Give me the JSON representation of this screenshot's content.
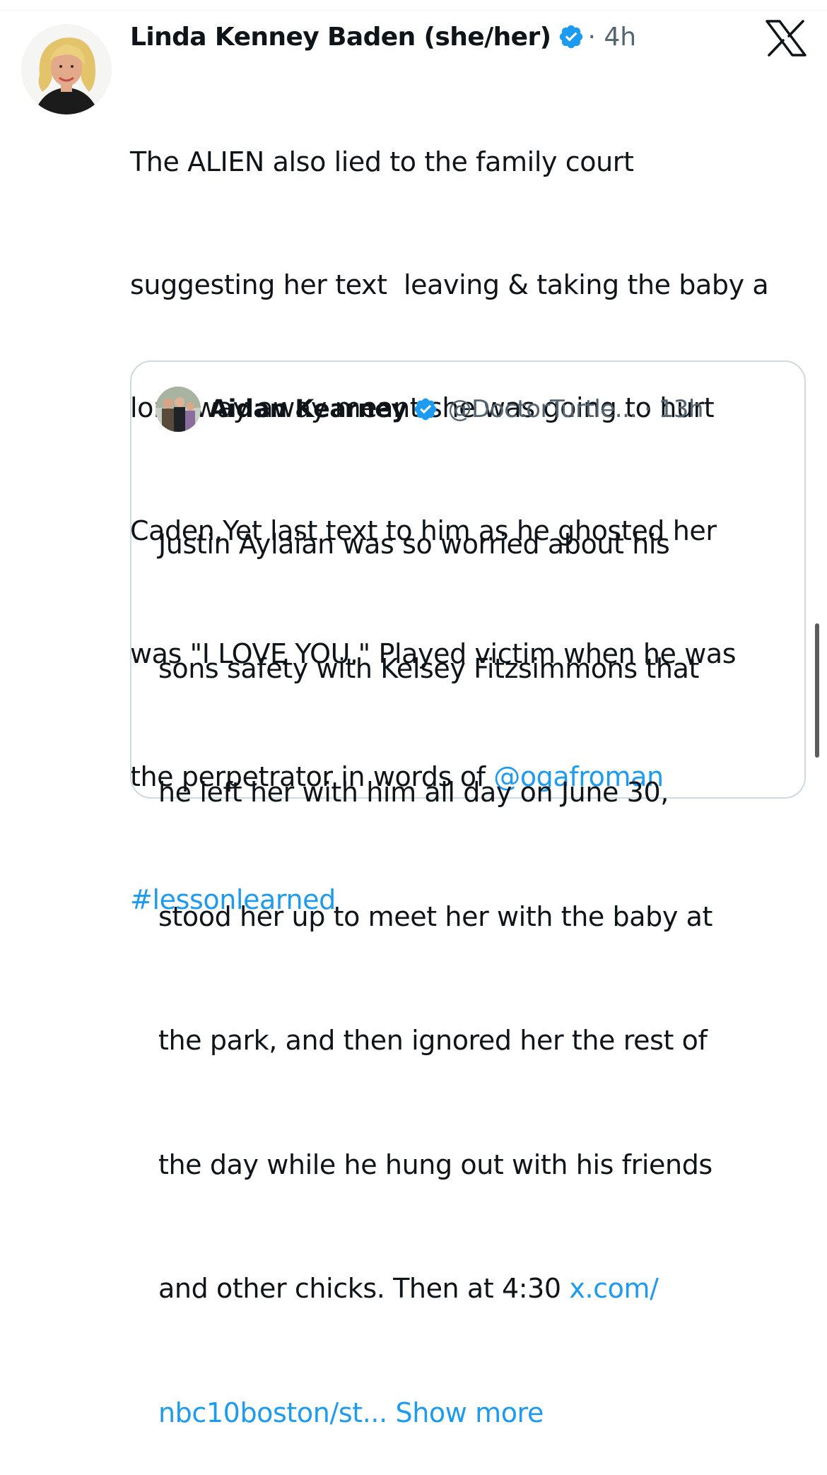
{
  "tweet": {
    "author_name": "Linda Kenney Baden (she/her)",
    "meta": "· 4h",
    "text_line_1": "The ALIEN also lied to the family court",
    "text_line_2": "suggesting her text  leaving & taking the baby a",
    "text_line_3": "long way away meant she was going to hurt",
    "text_line_4": "Caden.Yet last text to him as he ghosted her",
    "text_line_5": "was \"I LOVE YOU.\" Played victim when he was",
    "text_line_6_prefix": "the perpetrator in words of ",
    "mention": "@ogafroman",
    "hashtag": "#lessonlearned",
    "avatar_icon": "profile-photo-woman-blonde",
    "verified_icon": "verified-badge-icon"
  },
  "brand": {
    "logo_icon": "x-logo-icon"
  },
  "quote": {
    "author_name": "Aidan Kearney",
    "handle_meta": "@DoctorTurtle... · 13h",
    "text_line_1": "Justin Aylaian was so worried about his",
    "text_line_2": "sons safety with Kelsey Fitzsimmons that",
    "text_line_3": "he left her with him all day on June 30,",
    "text_line_4": "stood her up to meet her with the baby at",
    "text_line_5": "the park, and then ignored her the rest of",
    "text_line_6": "the day while he hung out with his friends",
    "text_line_7_prefix": "and other chicks. Then at 4:30 ",
    "link_part_1": "x.com/",
    "link_part_2": "nbc10boston/st...",
    "show_more": " Show more",
    "avatar_icon": "profile-photo-group"
  },
  "colors": {
    "link": "#1d9bf0",
    "text": "#0f1419",
    "secondary": "#536471",
    "border": "#cfd9de"
  }
}
